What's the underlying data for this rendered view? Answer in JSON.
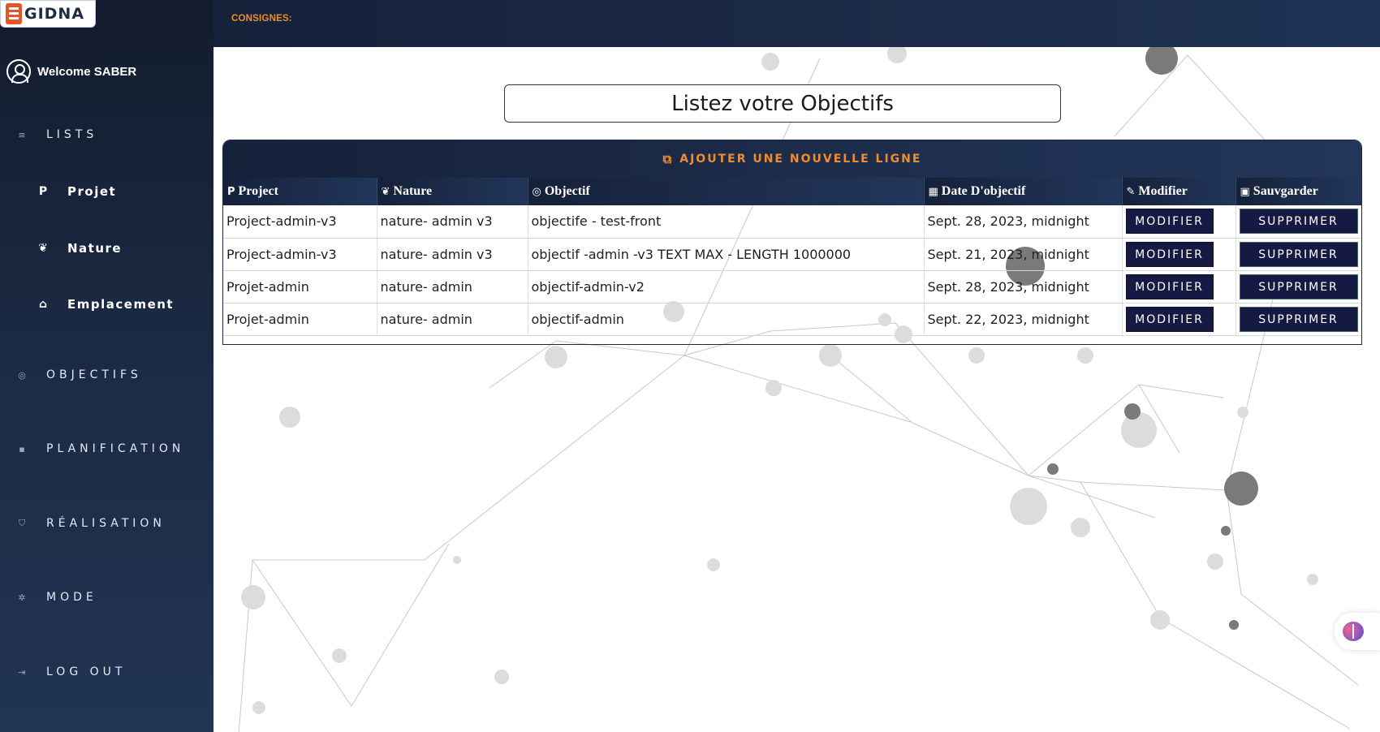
{
  "header": {
    "consignes_label": "CONSIGNES:"
  },
  "logo": {
    "text": "GIDNA"
  },
  "sidebar": {
    "welcome": "Welcome SABER",
    "lists": {
      "label": "LISTS",
      "icon": "list-icon"
    },
    "sub_items": [
      {
        "label": "Projet",
        "icon": "p-letter-icon"
      },
      {
        "label": "Nature",
        "icon": "leaf-icon"
      },
      {
        "label": "Emplacement",
        "icon": "bank-icon"
      }
    ],
    "items": [
      {
        "label": "OBJECTIFS",
        "icon": "target-icon"
      },
      {
        "label": "PLANIFICATION",
        "icon": "calendar-icon"
      },
      {
        "label": "RÉALISATION",
        "icon": "shield-check-icon"
      },
      {
        "label": "MODE",
        "icon": "gear-icon"
      },
      {
        "label": "LOG OUT",
        "icon": "logout-icon"
      }
    ]
  },
  "main": {
    "title": "Listez votre Objectifs",
    "add_line_label": "AJOUTER UNE NOUVELLE LIGNE",
    "columns": [
      {
        "label": "Project",
        "icon": "p-letter-icon"
      },
      {
        "label": "Nature",
        "icon": "leaf-icon"
      },
      {
        "label": "Objectif",
        "icon": "target-icon"
      },
      {
        "label": "Date D'objectif",
        "icon": "calendar-icon"
      },
      {
        "label": "Modifier",
        "icon": "edit-icon"
      },
      {
        "label": "Sauvgarder",
        "icon": "save-icon"
      }
    ],
    "rows": [
      {
        "project": "Project-admin-v3",
        "nature": "nature- admin v3",
        "objectif": "objectife - test-front",
        "date": "Sept. 28, 2023, midnight",
        "modify": "MODIFIER",
        "delete": "SUPPRIMER"
      },
      {
        "project": "Project-admin-v3",
        "nature": "nature- admin v3",
        "objectif": "objectif -admin -v3 TEXT MAX - LENGTH 1000000",
        "date": "Sept. 21, 2023, midnight",
        "modify": "MODIFIER",
        "delete": "SUPPRIMER"
      },
      {
        "project": "Projet-admin",
        "nature": "nature- admin",
        "objectif": "objectif-admin-v2",
        "date": "Sept. 28, 2023, midnight",
        "modify": "MODIFIER",
        "delete": "SUPPRIMER"
      },
      {
        "project": "Projet-admin",
        "nature": "nature- admin",
        "objectif": "objectif-admin",
        "date": "Sept. 22, 2023, midnight",
        "modify": "MODIFIER",
        "delete": "SUPPRIMER"
      }
    ]
  },
  "colors": {
    "accent": "#f08c2e",
    "sidebar_dark": "#131c2d",
    "button_bg": "#151943"
  },
  "widgets": {
    "assistant_icon": "brain-icon"
  }
}
